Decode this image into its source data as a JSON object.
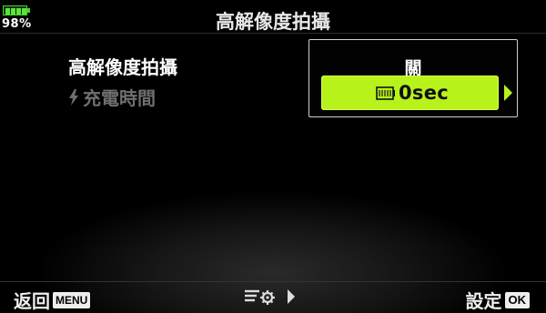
{
  "status": {
    "battery_percent": "98%",
    "battery_level": 0.98
  },
  "header": {
    "title": "高解像度拍攝"
  },
  "menu": {
    "items": [
      {
        "label": "高解像度拍攝",
        "state": "selected"
      },
      {
        "label": "充電時間",
        "state": "disabled",
        "icon": "lightning-bolt-icon"
      }
    ]
  },
  "value_panel": {
    "label": "關",
    "value": "0sec",
    "value_icon": "timer-icon",
    "accent_color": "#b8f21b"
  },
  "footer": {
    "back_label": "返回",
    "menu_badge": "MENU",
    "middle_icon": "settings-list-icon",
    "set_label": "設定",
    "ok_badge": "OK"
  }
}
